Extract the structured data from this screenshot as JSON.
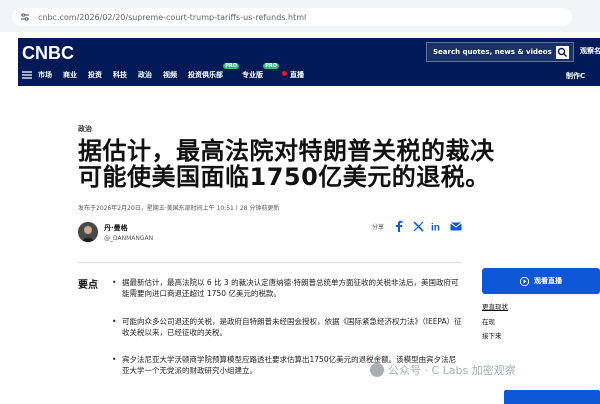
{
  "browser": {
    "url": "cnbc.com/2026/02/20/supreme-court-trump-tariffs-us-refunds.html"
  },
  "header": {
    "logo_text": "CNBC",
    "search_placeholder": "Search quotes, news & videos",
    "account_label": "观察名",
    "make_cnbc_label": "制作C",
    "nav": [
      {
        "label": "市场"
      },
      {
        "label": "商业"
      },
      {
        "label": "投资"
      },
      {
        "label": "科技"
      },
      {
        "label": "政治"
      },
      {
        "label": "视频"
      },
      {
        "label": "投资俱乐部",
        "badge": "PRO"
      },
      {
        "label": "专业版",
        "badge": "PRO"
      },
      {
        "label": "直播"
      }
    ],
    "colors": {
      "navy": "#001a57",
      "live_red": "#e31b23",
      "pro_green": "#2ec16f"
    }
  },
  "article": {
    "section": "政治",
    "headline_line1": "据估计，最高法院对特朗普关税的裁决",
    "headline_line2": "可能使美国面临1750亿美元的退税。",
    "published": "发布于2026年2月20日，星期五·美国东部时间上午 10:51丨28 分钟前更新",
    "author_name": "丹·曼格",
    "author_handle": "@_DANMANGAN",
    "share_label": "分享",
    "key_points_title": "要点",
    "key_points": [
      "据最新估计，最高法院以 6 比 3 的裁决认定唐纳德·特朗普总统单方面征收的关税非法后，美国政府可能需要向进口商退还超过 1750 亿美元的税款。",
      "可能向众多公司退还的关税，是政府自特朗普未经国会授权，依据《国际紧急经济权力法》（IEEPA）征收关税以来，已经征收的关税。",
      "宾夕法尼亚大学沃顿商学院预算模型应路透社要求估算出1750亿美元的退税金额。该模型由宾夕法尼亚大学一个无党派的财政研究小组建立。"
    ]
  },
  "sidebar": {
    "live_button": "观看直播",
    "links": [
      "更直现状",
      "在现",
      "接下来"
    ],
    "accent_color": "#0e57d9"
  },
  "watermark": {
    "text": "公众号 · C Labs 加密观察"
  }
}
